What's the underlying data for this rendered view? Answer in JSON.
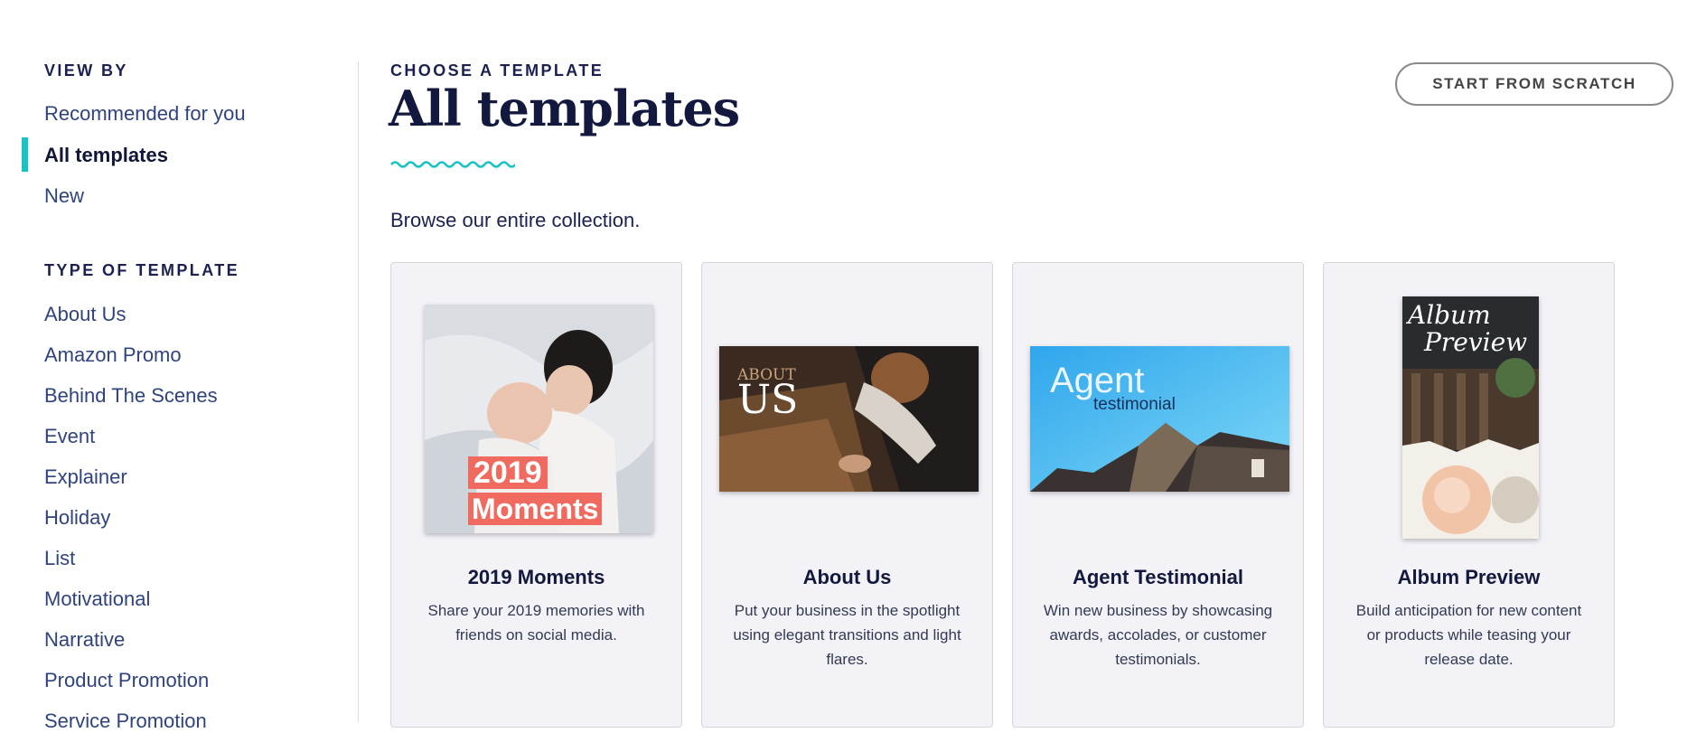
{
  "sidebar": {
    "view_by_heading": "VIEW BY",
    "view_by_items": [
      "Recommended for you",
      "All templates",
      "New"
    ],
    "active_item": "All templates",
    "type_heading": "TYPE OF TEMPLATE",
    "type_items": [
      "About Us",
      "Amazon Promo",
      "Behind The Scenes",
      "Event",
      "Explainer",
      "Holiday",
      "List",
      "Motivational",
      "Narrative",
      "Product Promotion",
      "Service Promotion"
    ]
  },
  "header": {
    "eyebrow": "CHOOSE A TEMPLATE",
    "title": "All templates",
    "subtitle": "Browse our entire collection.",
    "scratch_button": "START FROM SCRATCH"
  },
  "cards": [
    {
      "title": "2019 Moments",
      "description": "Share your 2019 memories with friends on social media.",
      "thumb_text": [
        "2019",
        "Moments"
      ]
    },
    {
      "title": "About Us",
      "description": "Put your business in the spotlight using elegant transitions and light flares.",
      "thumb_text": [
        "ABOUT",
        "US"
      ]
    },
    {
      "title": "Agent Testimonial",
      "description": "Win new business by showcasing awards, accolades, or customer testimonials.",
      "thumb_text": [
        "Agent",
        "testimonial"
      ]
    },
    {
      "title": "Album Preview",
      "description": "Build anticipation for new content or products while teasing your release date.",
      "thumb_text": [
        "Album",
        "Preview"
      ]
    }
  ],
  "colors": {
    "accent": "#19c2c7",
    "heading": "#13183f",
    "link": "#2f437f",
    "card_bg": "#f2f2f7"
  }
}
